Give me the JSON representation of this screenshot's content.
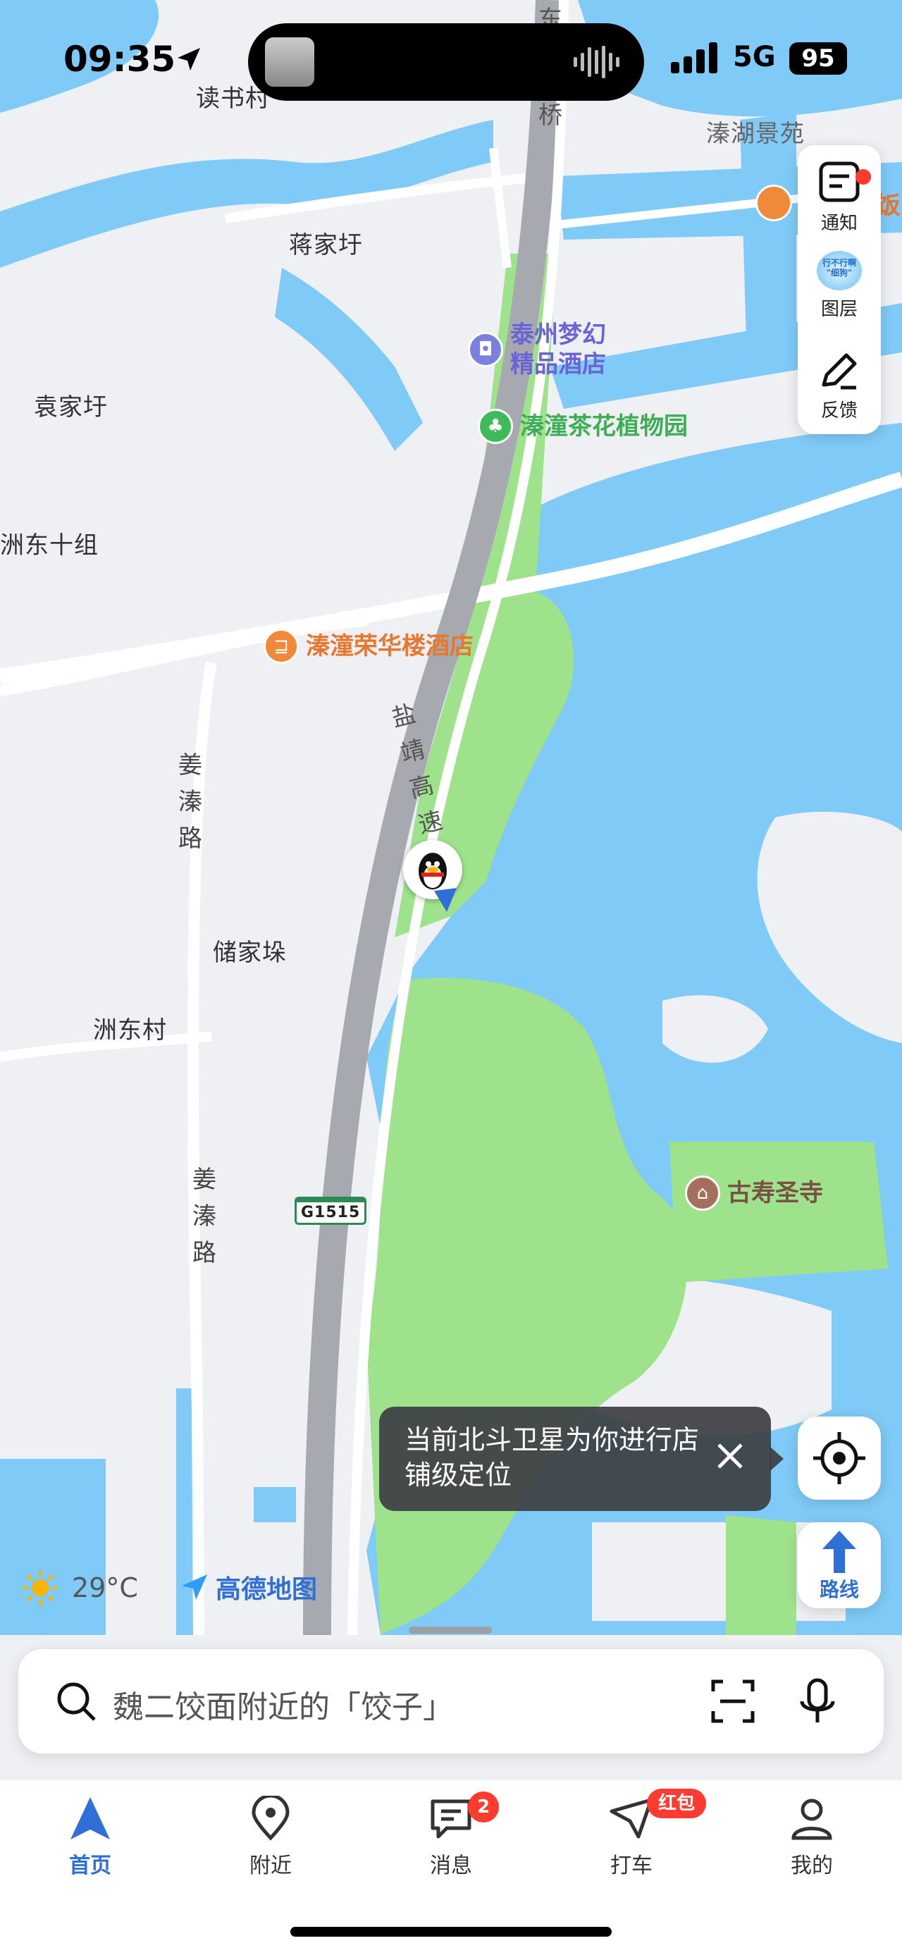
{
  "status_bar": {
    "time": "09:35",
    "network": "5G",
    "battery": "95"
  },
  "map_labels": {
    "dushucun": "读书村",
    "jiangjiawei": "蒋家圩",
    "yuanjiawei": "袁家圩",
    "zhoudong10": "洲东十组",
    "chujiawu": "储家垛",
    "zhoudongcun": "洲东村",
    "qinhujingyuan": "溱湖景苑",
    "jiangqinlu_a": "姜溱路",
    "jiangqinlu_b": "姜溱路",
    "yanjing": "盐靖高速",
    "dong": "东",
    "qiao": "桥",
    "fan": "饭",
    "g1515": "G1515"
  },
  "pois": {
    "hotel1": "泰州梦幻\n精品酒店",
    "garden": "溱潼茶花植物园",
    "hotel2": "溱潼荣华楼酒店",
    "temple": "古寿圣寺"
  },
  "tools": {
    "notify": "通知",
    "layers": "图层",
    "layer_badge": "行不行啊\n\"细狗\"",
    "feedback": "反馈"
  },
  "tip": {
    "text": "当前北斗卫星为你进行店铺级定位"
  },
  "route": {
    "label": "路线"
  },
  "weather": {
    "temp": "29°C"
  },
  "brand": {
    "name": "高德地图"
  },
  "search": {
    "placeholder": "魏二饺面附近的「饺子」"
  },
  "tabs": [
    {
      "label": "首页"
    },
    {
      "label": "附近"
    },
    {
      "label": "消息",
      "badge": "2"
    },
    {
      "label": "打车",
      "badge": "红包"
    },
    {
      "label": "我的"
    }
  ],
  "colors": {
    "water": "#7fcaf7",
    "land": "#eef0f3",
    "green": "#9fe28c",
    "highway": "#a6aab0",
    "accent": "#2f6fd6"
  }
}
